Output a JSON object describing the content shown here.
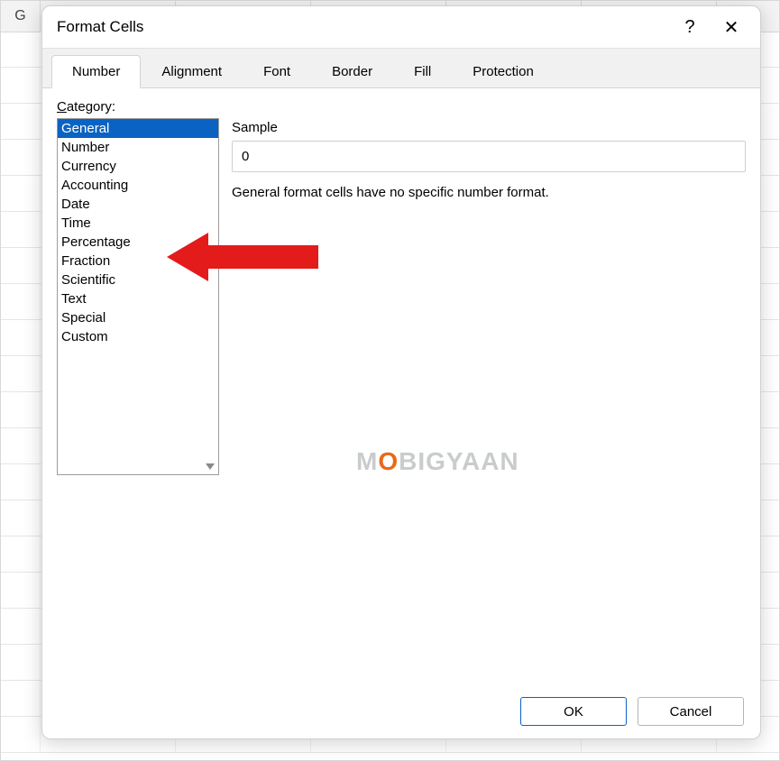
{
  "sheet": {
    "column_header": "G"
  },
  "dialog": {
    "title": "Format Cells",
    "help_symbol": "?",
    "close_symbol": "✕"
  },
  "tabs": [
    {
      "label": "Number",
      "active": true
    },
    {
      "label": "Alignment",
      "active": false
    },
    {
      "label": "Font",
      "active": false
    },
    {
      "label": "Border",
      "active": false
    },
    {
      "label": "Fill",
      "active": false
    },
    {
      "label": "Protection",
      "active": false
    }
  ],
  "number_tab": {
    "category_label_prefix": "C",
    "category_label_rest": "ategory:",
    "categories": [
      "General",
      "Number",
      "Currency",
      "Accounting",
      "Date",
      "Time",
      "Percentage",
      "Fraction",
      "Scientific",
      "Text",
      "Special",
      "Custom"
    ],
    "selected_category": "General",
    "sample_label": "Sample",
    "sample_value": "0",
    "description": "General format cells have no specific number format."
  },
  "footer": {
    "ok": "OK",
    "cancel": "Cancel"
  },
  "watermark": {
    "pre": "M",
    "dot": "O",
    "post": "BIGYAAN"
  }
}
